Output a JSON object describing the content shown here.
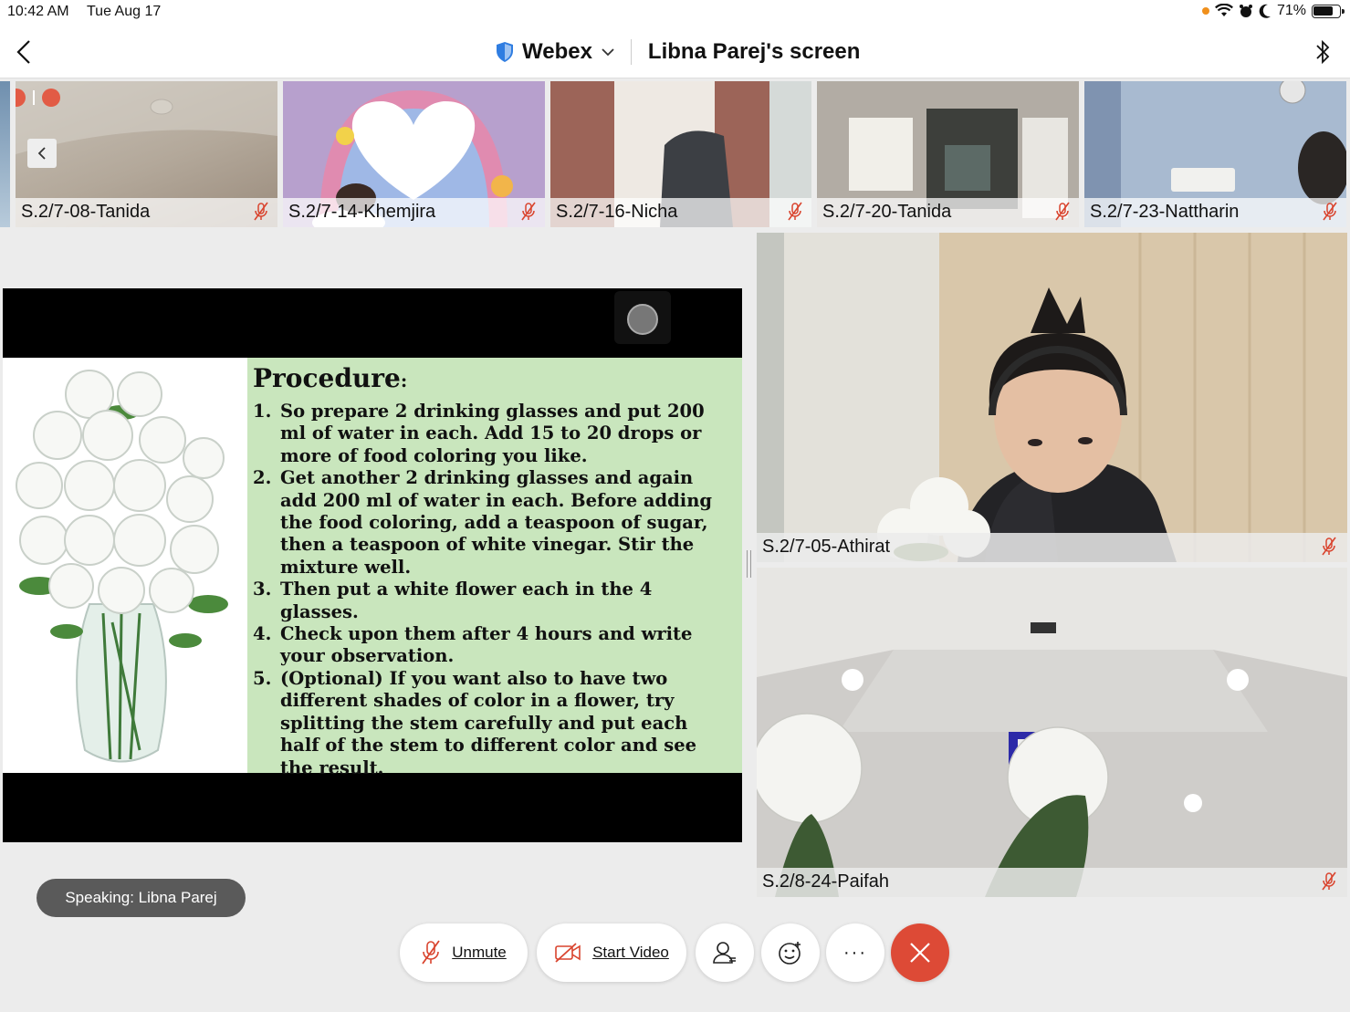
{
  "status_bar": {
    "time": "10:42 AM",
    "date": "Tue Aug 17",
    "battery": "71%"
  },
  "nav": {
    "app_name": "Webex",
    "title": "Libna Parej's screen"
  },
  "thumbnails": [
    {
      "name": "S.2/7-08-Tanida"
    },
    {
      "name": "S.2/7-14-Khemjira"
    },
    {
      "name": "S.2/7-16-Nicha"
    },
    {
      "name": "S.2/7-20-Tanida"
    },
    {
      "name": "S.2/7-23-Nattharin"
    }
  ],
  "slide": {
    "title": "Procedure",
    "title_suffix": ":",
    "steps": [
      {
        "num": "1.",
        "text": "So prepare 2 drinking glasses and put 200 ml of water in each. Add 15 to 20 drops or more of food coloring you like."
      },
      {
        "num": "2.",
        "text": "Get another 2 drinking glasses and again add 200 ml of water in each. Before adding the food coloring, add a teaspoon of sugar, then a teaspoon of white vinegar. Stir the mixture well."
      },
      {
        "num": "3.",
        "text": "Then put a white flower each in the 4 glasses."
      },
      {
        "num": "4.",
        "text": "Check upon them after 4 hours and write your observation."
      },
      {
        "num": "5.",
        "text": "(Optional) If you want also to have two different shades of color in a flower, try splitting the stem carefully and put each half of the stem to different color and see the result."
      }
    ]
  },
  "videos": [
    {
      "name": "S.2/7-05-Athirat"
    },
    {
      "name": "S.2/8-24-Paifah"
    }
  ],
  "speaking": "Speaking: Libna Parej",
  "controls": {
    "unmute": "Unmute",
    "start_video": "Start Video",
    "more": "···"
  },
  "colors": {
    "accent_blue": "#2f7de1",
    "end_red": "#dd4a36",
    "mute_red": "#d9442e",
    "slide_green": "#c9e6bd"
  }
}
